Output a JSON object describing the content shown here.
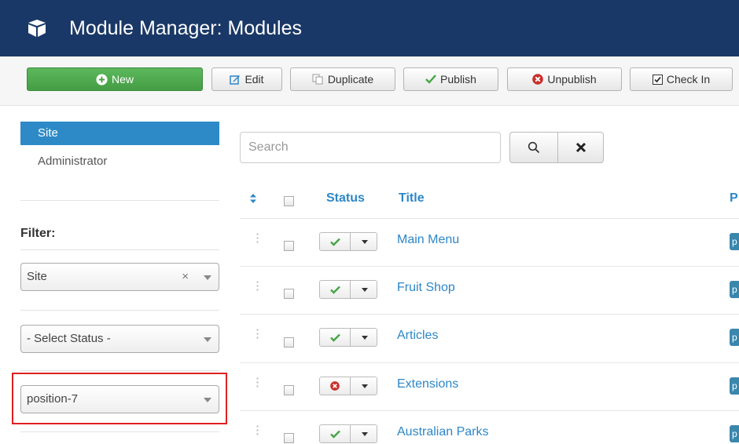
{
  "header": {
    "title": "Module Manager: Modules"
  },
  "toolbar": {
    "new": "New",
    "edit": "Edit",
    "duplicate": "Duplicate",
    "publish": "Publish",
    "unpublish": "Unpublish",
    "checkin": "Check In"
  },
  "sidebar": {
    "items": [
      {
        "label": "Site",
        "active": true
      },
      {
        "label": "Administrator",
        "active": false
      }
    ],
    "filter_label": "Filter:",
    "filters": {
      "client": "Site",
      "client_clear": "×",
      "status": "- Select Status -",
      "position": "position-7"
    }
  },
  "search": {
    "placeholder": "Search"
  },
  "table": {
    "headers": {
      "status": "Status",
      "title": "Title",
      "position_abbr": "P"
    },
    "rows": [
      {
        "title": "Main Menu",
        "published": true,
        "badge": "p"
      },
      {
        "title": "Fruit Shop",
        "published": true,
        "badge": "p"
      },
      {
        "title": "Articles",
        "published": true,
        "badge": "p"
      },
      {
        "title": "Extensions",
        "published": false,
        "badge": "p"
      },
      {
        "title": "Australian Parks",
        "published": true,
        "badge": "p"
      }
    ]
  },
  "colors": {
    "header_bg": "#1a3867",
    "new_button": "#5cb85c",
    "link": "#2d87c7",
    "active_nav": "#2d8ac7",
    "highlight": "#e02020"
  }
}
